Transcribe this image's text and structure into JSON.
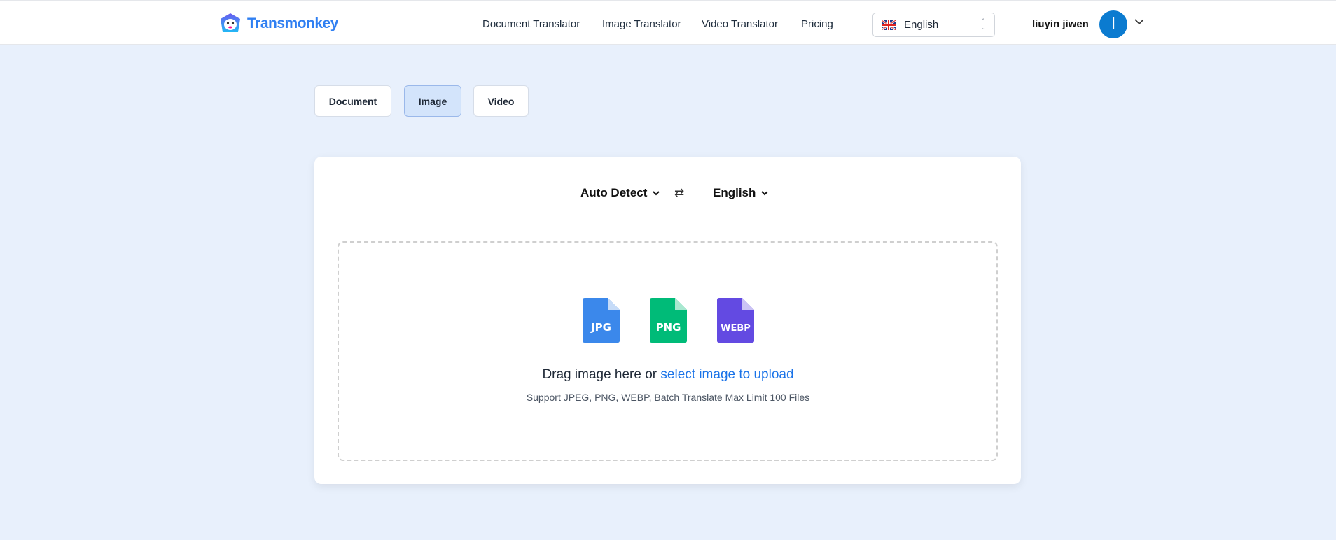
{
  "header": {
    "brand": "Transmonkey",
    "nav": [
      "Document Translator",
      "Image Translator",
      "Video Translator",
      "Pricing"
    ],
    "language": "English",
    "username": "liuyin jiwen",
    "avatar_initial": "l"
  },
  "tabs": [
    "Document",
    "Image",
    "Video"
  ],
  "active_tab": "Image",
  "translator": {
    "source_lang": "Auto Detect",
    "target_lang": "English",
    "swap_icon": "⇄"
  },
  "upload": {
    "formats": [
      {
        "label": "JPG",
        "color": "#3b88eb",
        "fold": "#c5dbf8"
      },
      {
        "label": "PNG",
        "color": "#00bb78",
        "fold": "#a8e8d0"
      },
      {
        "label": "WEBP",
        "color": "#634ae2",
        "fold": "#cbc3f5"
      }
    ],
    "drag_text": "Drag image here or",
    "link_text": "select image to upload",
    "support_text": "Support JPEG, PNG, WEBP, Batch Translate Max Limit 100 Files"
  }
}
